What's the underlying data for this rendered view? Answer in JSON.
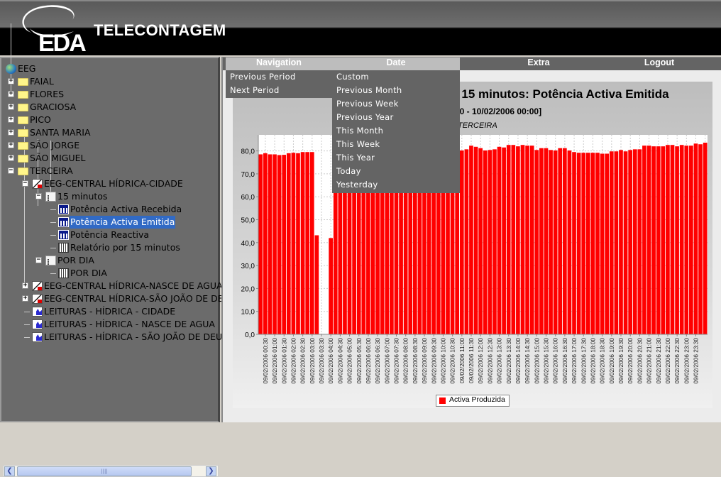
{
  "header": {
    "brand": "TELECONTAGEM",
    "logo_text": "EDA"
  },
  "tree": {
    "root": "EEG",
    "islands": [
      "FAIAL",
      "FLORES",
      "GRACIOSA",
      "PICO",
      "SANTA MARIA",
      "SÃO JORGE",
      "SÃO MIGUEL",
      "TERCEIRA"
    ],
    "central_cidade": "EEG-CENTRAL HÍDRICA-CIDADE",
    "group_15min": "15 minutos",
    "items_15min": [
      "Potência Activa  Recebida",
      "Potência Activa Emitida",
      "Potência Reactiva",
      "Relatório por 15 minutos"
    ],
    "group_dia": "POR DIA",
    "item_dia": "POR DIA",
    "central_nasce": "EEG-CENTRAL HÍDRICA-NASCE DE AGUA",
    "central_sjoao": "EEG-CENTRAL HÍDRICA-SÃO JOÃO DE DEUS",
    "leituras": [
      "LEITURAS - HÍDRICA - CIDADE",
      "LEITURAS - HÍDRICA - NASCE DE AGUA",
      "LEITURAS - HÍDRICA - SÃO JOÃO DE DEUS"
    ],
    "selected": "Potência Activa Emitida"
  },
  "menu": {
    "items": [
      "Navigation",
      "Date",
      "Extra",
      "Logout"
    ],
    "navigation": [
      "Previous Period",
      "Next Period"
    ],
    "date": [
      "Custom",
      "Previous Month",
      "Previous Week",
      "Previous Year",
      "This Month",
      "This Week",
      "This Year",
      "Today",
      "Yesterday"
    ]
  },
  "chart_data": {
    "type": "bar",
    "title": ": 15 minutos: Potência Activa Emitida",
    "subtitle": "00 - 10/02/2006 00:00]",
    "note": "/TERCEIRA",
    "ylim": [
      0,
      87
    ],
    "y_ticks": [
      "0,0",
      "10,0",
      "20,0",
      "30,0",
      "40,0",
      "50,0",
      "60,0",
      "70,0",
      "80,0"
    ],
    "x_tick_labels": [
      "09/02/2006 00:30",
      "09/02/2006 01:00",
      "09/02/2006 01:30",
      "09/02/2006 02:00",
      "09/02/2006 02:30",
      "09/02/2006 03:00",
      "09/02/2006 03:30",
      "09/02/2006 04:00",
      "09/02/2006 04:30",
      "09/02/2006 05:00",
      "09/02/2006 05:30",
      "09/02/2006 06:00",
      "09/02/2006 06:30",
      "09/02/2006 07:00",
      "09/02/2006 07:30",
      "09/02/2006 08:00",
      "09/02/2006 08:30",
      "09/02/2006 09:00",
      "09/02/2006 09:30",
      "09/02/2006 10:00",
      "09/02/2006 10:30",
      "09/02/2006 11:00",
      "09/02/2006 11:30",
      "09/02/2006 12:00",
      "09/02/2006 12:30",
      "09/02/2006 13:00",
      "09/02/2006 13:30",
      "09/02/2006 14:00",
      "09/02/2006 14:30",
      "09/02/2006 15:00",
      "09/02/2006 15:30",
      "09/02/2006 16:00",
      "09/02/2006 16:30",
      "09/02/2006 17:00",
      "09/02/2006 17:30",
      "09/02/2006 18:00",
      "09/02/2006 18:30",
      "09/02/2006 19:00",
      "09/02/2006 19:30",
      "09/02/2006 20:00",
      "09/02/2006 20:30",
      "09/02/2006 21:00",
      "09/02/2006 21:30",
      "09/02/2006 22:00",
      "09/02/2006 22:30",
      "09/02/2006 23:00",
      "09/02/2006 23:30"
    ],
    "series": [
      {
        "name": "Activa Produzida",
        "color": "#ff0000",
        "values": [
          78.5,
          79,
          78.5,
          78.5,
          78.2,
          78.3,
          79,
          79.2,
          79,
          79.5,
          79.5,
          79.5,
          43.2,
          0,
          0,
          42,
          79.5,
          79.8,
          80,
          79.5,
          79.8,
          80,
          80.2,
          80,
          79.8,
          80,
          80.3,
          80.5,
          80.2,
          80,
          79.8,
          80,
          80.2,
          80.5,
          80.3,
          80,
          79.8,
          80,
          80.2,
          80.5,
          80.3,
          80.5,
          81,
          80.2,
          80.7,
          82.3,
          81.8,
          81.2,
          80.2,
          80.4,
          80.7,
          81.8,
          81.5,
          82.6,
          82.6,
          82,
          82.6,
          82.3,
          82.3,
          80.4,
          81.2,
          81.2,
          80.4,
          80.2,
          81.2,
          81.2,
          80.2,
          79.5,
          79.2,
          79.2,
          79.2,
          79.2,
          79.2,
          78.8,
          78.8,
          79.8,
          79.8,
          80.4,
          79.8,
          80.4,
          80.7,
          80.7,
          82.3,
          82.3,
          82,
          82,
          82,
          82.6,
          82.6,
          82,
          82.6,
          82.3,
          82.3,
          83.2,
          82.9,
          83.6
        ]
      }
    ],
    "grid": true,
    "legend": "bottom"
  }
}
